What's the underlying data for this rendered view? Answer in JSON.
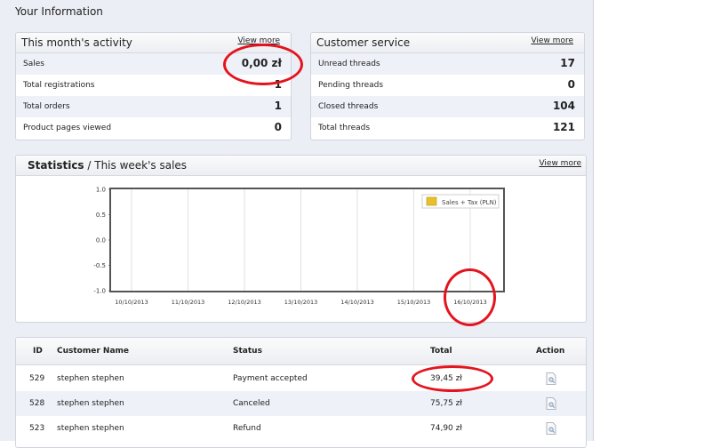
{
  "page_title": "Your Information",
  "activity": {
    "title": "This month's activity",
    "view_more": "View more",
    "rows": [
      {
        "label": "Sales",
        "value": "0,00 zł"
      },
      {
        "label": "Total registrations",
        "value": "1"
      },
      {
        "label": "Total orders",
        "value": "1"
      },
      {
        "label": "Product pages viewed",
        "value": "0"
      }
    ]
  },
  "customer_service": {
    "title": "Customer service",
    "view_more": "View more",
    "rows": [
      {
        "label": "Unread threads",
        "value": "17"
      },
      {
        "label": "Pending threads",
        "value": "0"
      },
      {
        "label": "Closed threads",
        "value": "104"
      },
      {
        "label": "Total threads",
        "value": "121"
      }
    ]
  },
  "statistics": {
    "title_bold": "Statistics",
    "title_rest": " / This week's sales",
    "view_more": "View more"
  },
  "chart_data": {
    "type": "line",
    "x": [
      "10/10/2013",
      "11/10/2013",
      "12/10/2013",
      "13/10/2013",
      "14/10/2013",
      "15/10/2013",
      "16/10/2013"
    ],
    "series": [
      {
        "name": "Sales + Tax (PLN)",
        "values": []
      }
    ],
    "y_ticks": [
      "1.0",
      "0.5",
      "0.0",
      "-0.5",
      "-1.0"
    ],
    "ylim": [
      -1.0,
      1.0
    ],
    "legend_position": "top-right",
    "legend_color": "#e8c02a",
    "grid": true
  },
  "orders": {
    "columns": [
      "ID",
      "Customer Name",
      "Status",
      "Total",
      "Action"
    ],
    "rows": [
      {
        "id": "529",
        "customer": "stephen stephen",
        "status": "Payment accepted",
        "total": "39,45 zł"
      },
      {
        "id": "528",
        "customer": "stephen stephen",
        "status": "Canceled",
        "total": "75,75 zł"
      },
      {
        "id": "523",
        "customer": "stephen stephen",
        "status": "Refund",
        "total": "74,90 zł"
      }
    ],
    "action_icon": "view-document-icon"
  },
  "annotation_color": "#e4141e"
}
